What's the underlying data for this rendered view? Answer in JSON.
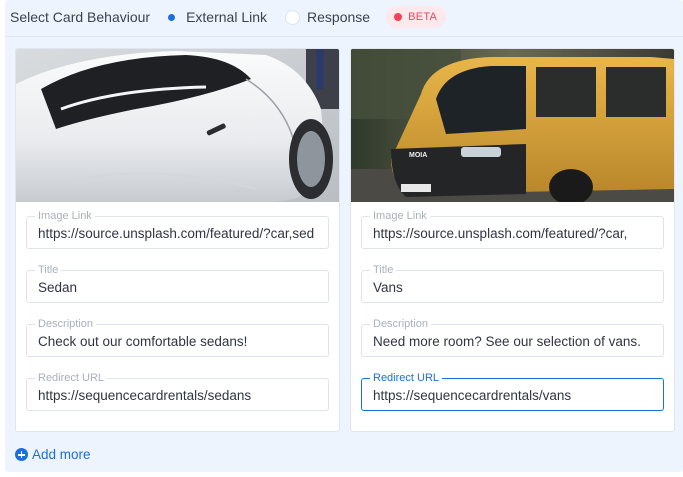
{
  "behaviour": {
    "label": "Select Card Behaviour",
    "options": [
      {
        "label": "External Link",
        "selected": true
      },
      {
        "label": "Response",
        "selected": false
      }
    ],
    "badge": "BETA"
  },
  "cards": [
    {
      "image_description": "white sports car side view",
      "fields": {
        "image_link": {
          "label": "Image Link",
          "value": "https://source.unsplash.com/featured/?car,sed"
        },
        "title": {
          "label": "Title",
          "value": "Sedan"
        },
        "description": {
          "label": "Description",
          "value": "Check out our comfortable sedans!"
        },
        "redirect_url": {
          "label": "Redirect URL",
          "value": "https://sequencecardrentals/sedans"
        }
      }
    },
    {
      "image_description": "yellow van in motion",
      "fields": {
        "image_link": {
          "label": "Image Link",
          "value": "https://source.unsplash.com/featured/?car,"
        },
        "title": {
          "label": "Title",
          "value": "Vans"
        },
        "description": {
          "label": "Description",
          "value": "Need more room? See our selection of vans."
        },
        "redirect_url": {
          "label": "Redirect URL",
          "value": "https://sequencecardrentals/vans",
          "focused": true
        }
      }
    }
  ],
  "add_more": {
    "label": "Add more",
    "icon": "plus-circle-icon"
  },
  "colors": {
    "accent": "#1a6fe0",
    "badge_red": "#f0425a",
    "panel_bg": "#eef4fd"
  }
}
